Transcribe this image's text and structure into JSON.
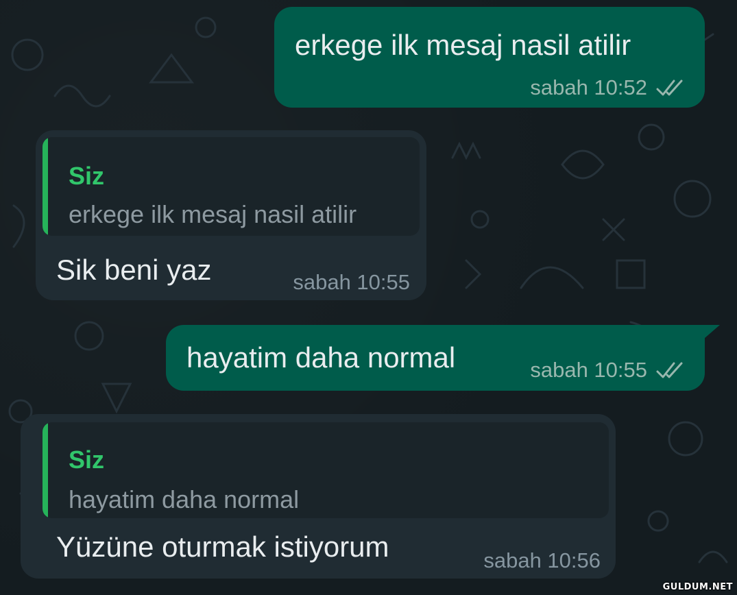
{
  "colors": {
    "background": "#141c20",
    "outgoing_bubble": "#005c4b",
    "incoming_bubble": "#202c33",
    "quote_accent": "#26b35a",
    "read_ticks": "#99b7ae"
  },
  "messages": [
    {
      "direction": "outgoing",
      "text": "erkege ilk mesaj nasil atilir",
      "time": "sabah 10:52",
      "status_icon": "double-check-icon"
    },
    {
      "direction": "incoming",
      "quote": {
        "author": "Siz",
        "text": "erkege ilk mesaj nasil atilir"
      },
      "text": "Sik beni yaz",
      "time": "sabah 10:55"
    },
    {
      "direction": "outgoing",
      "text": "hayatim daha normal",
      "time": "sabah 10:55",
      "status_icon": "double-check-icon"
    },
    {
      "direction": "incoming",
      "quote": {
        "author": "Siz",
        "text": "hayatim daha normal"
      },
      "text": "Yüzüne oturmak istiyorum",
      "time": "sabah 10:56"
    }
  ],
  "watermark": "GULDUM.NET"
}
